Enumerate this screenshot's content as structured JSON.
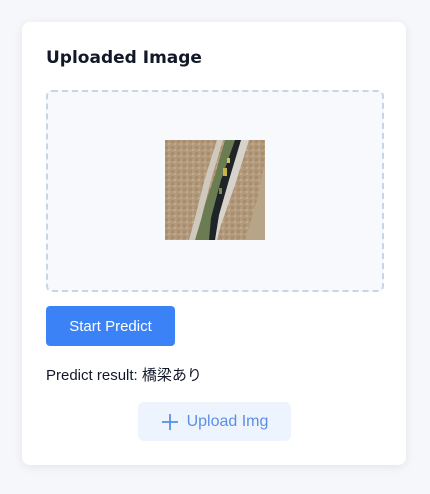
{
  "card": {
    "title": "Uploaded Image"
  },
  "actions": {
    "predict_label": "Start Predict",
    "upload_label": "Upload Img",
    "upload_icon": "plus-icon"
  },
  "result": {
    "label": "Predict result: ",
    "value": "橋梁あり"
  },
  "colors": {
    "primary": "#3b82f6",
    "upload_text": "#5b8fe6",
    "upload_bg": "#eef4fd",
    "dropzone_border": "#c9d5e6"
  }
}
